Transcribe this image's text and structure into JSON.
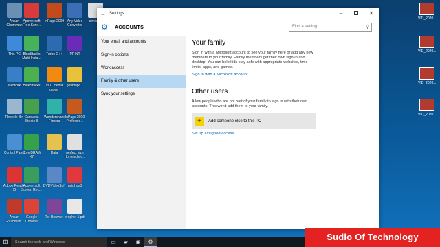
{
  "desktop": {
    "icons": [
      {
        "label": "Ahsan Ghumman",
        "color": "#6b8fb3"
      },
      {
        "label": "Apowersoft Free Scre...",
        "color": "#d93a3a"
      },
      {
        "label": "InPage 2009",
        "color": "#c24a1b"
      },
      {
        "label": "Any Video Converter",
        "color": "#3a6fb5"
      },
      {
        "label": "similar...",
        "color": "#dddddd"
      },
      {
        "label": "This PC",
        "color": "#3f8ad8"
      },
      {
        "label": "BlueStacks Multi-Insta...",
        "color": "#46b35a"
      },
      {
        "label": "Turbo C++",
        "color": "#2d6bb0"
      },
      {
        "label": "PRINT",
        "color": "#6a2bb8"
      },
      {
        "label": "Network",
        "color": "#3a7ec8"
      },
      {
        "label": "BlueStacks",
        "color": "#4cb050"
      },
      {
        "label": "VLC media player",
        "color": "#f08a10"
      },
      {
        "label": "getintopc...",
        "color": "#e8c23a"
      },
      {
        "label": "Recycle Bin",
        "color": "#9bb7cf"
      },
      {
        "label": "Camtasia Studio 8",
        "color": "#47a04b"
      },
      {
        "label": "Wondershare Filmora",
        "color": "#2fb3a8"
      },
      {
        "label": "InPage 2010 Professio...",
        "color": "#c45a1e"
      },
      {
        "label": "Control Panel",
        "color": "#4a8fcf"
      },
      {
        "label": "CorelDRAW X7",
        "color": "#36a14a"
      },
      {
        "label": "Data",
        "color": "#e5c24f"
      },
      {
        "label": "perfect size Homeschoo...",
        "color": "#e0e0e0"
      },
      {
        "label": "Adobe Reader XI",
        "color": "#d33"
      },
      {
        "label": "Apowersoft Screen Rec...",
        "color": "#3a9d5d"
      },
      {
        "label": "DVDVideoSoft",
        "color": "#5a87c5"
      },
      {
        "label": "psiphon3",
        "color": "#e0383e"
      },
      {
        "label": "Ahsan Ghumman...",
        "color": "#c0392b"
      },
      {
        "label": "Google Chrome",
        "color": "#db4437"
      },
      {
        "label": "Tor Browser",
        "color": "#7d4698"
      },
      {
        "label": "prophet 1.pdf",
        "color": "#e8e8e8"
      }
    ],
    "right_thumbs": [
      "VID_2020...",
      "VID_2020...",
      "VID_2020...",
      "VID_2020..."
    ]
  },
  "window": {
    "title": "Settings",
    "header": "ACCOUNTS",
    "search_placeholder": "Find a setting",
    "nav": [
      "Your email and accounts",
      "Sign-in options",
      "Work access",
      "Family & other users",
      "Sync your settings"
    ],
    "active_nav_index": 3,
    "family": {
      "heading": "Your family",
      "text": "Sign in with a Microsoft account to see your family here or add any new members to your family. Family members get their own sign-in and desktop. You can help kids stay safe with appropriate websites, time limits, apps, and games.",
      "link": "Sign in with a Microsoft account"
    },
    "other_users": {
      "heading": "Other users",
      "text": "Allow people who are not part of your family to sign in with their own accounts. This won't add them to your family.",
      "add_button": "Add someone else to this PC",
      "link": "Set up assigned access"
    }
  },
  "taskbar": {
    "search_text": "Search the web and Windows"
  },
  "brand": "Sudio Of Technology"
}
